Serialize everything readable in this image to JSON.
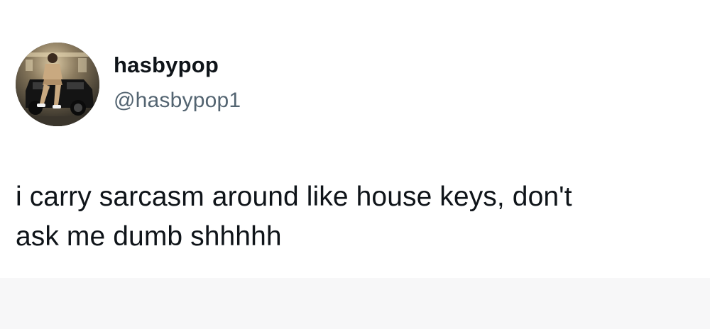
{
  "tweet": {
    "author": {
      "display_name": "hasbypop",
      "handle": "@hasbypop1",
      "avatar_icon": "profile-photo"
    },
    "text_lines": [
      "i carry sarcasm around like house keys, don't",
      "ask me dumb shhhhh"
    ]
  },
  "colors": {
    "background": "#ffffff",
    "primary_text": "#0f1419",
    "secondary_text": "#536471",
    "bottom_band": "#f7f7f8"
  }
}
